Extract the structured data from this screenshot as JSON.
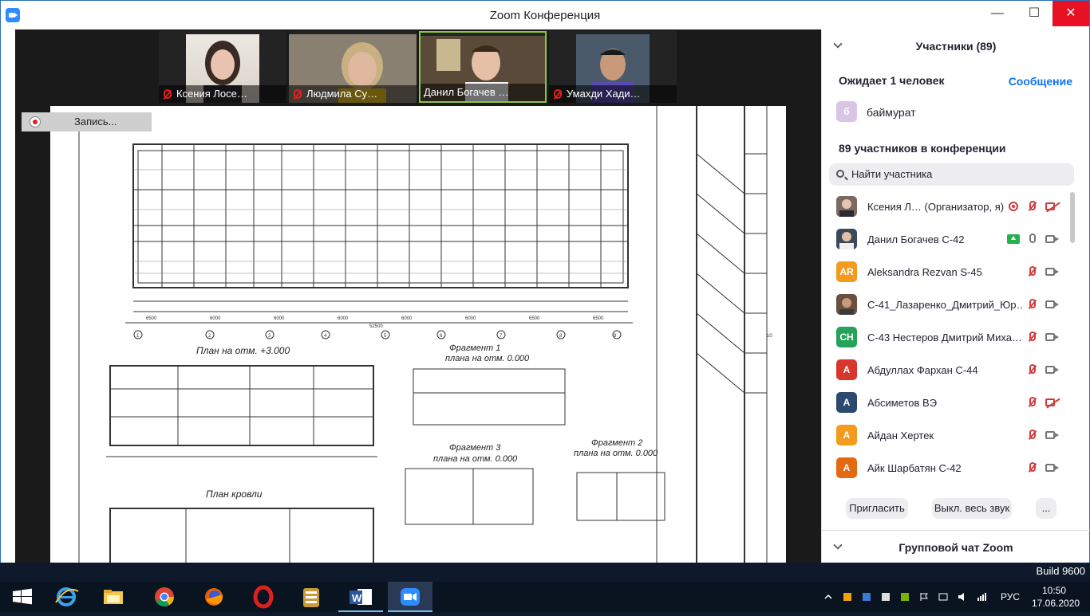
{
  "window": {
    "title": "Zoom Конференция",
    "minimize": "—",
    "maximize": "☐",
    "close": "✕"
  },
  "video": {
    "thumbnails": [
      {
        "name": "Ксения Лосе…",
        "active": false
      },
      {
        "name": "Людмила Су…",
        "active": false
      },
      {
        "name": "Данил Богачев …",
        "active": true
      },
      {
        "name": "Умахди Хади…",
        "active": false
      }
    ],
    "next_icon": "chevron-right-icon",
    "next_glyph": "›",
    "recording_label": "Запись...",
    "drawing": {
      "plan1": "План на отм. +3.000",
      "frag1": "Фрагмент 1",
      "frag1sub": "плана на отм. 0.000",
      "frag2": "Фрагмент 2",
      "frag2sub": "плана на отм. 0.000",
      "frag3": "Фрагмент 3",
      "frag3sub": "плана на отм. 0.000",
      "roof": "План кровли",
      "dim_total": "52500",
      "dim_row": [
        "6500",
        "6000",
        "6000",
        "6000",
        "6000",
        "6000",
        "6500",
        "6500"
      ],
      "axes": [
        "1",
        "2",
        "3",
        "4",
        "5",
        "6",
        "7",
        "8",
        "9",
        "10"
      ]
    }
  },
  "panel": {
    "participants_title": "Участники (89)",
    "waiting": "Ожидает 1 человек",
    "message_button": "Сообщение",
    "waiting_person": {
      "initial": "б",
      "name": "баймурат",
      "color": "#d9c6e6"
    },
    "in_conference": "89 участников в конференции",
    "search_placeholder": "Найти участника",
    "participants": [
      {
        "initial": "",
        "name": "Ксения Л…  (Организатор, я)",
        "color": "#7a6a62",
        "photo": true,
        "rec": true,
        "mic": "off",
        "cam": "off"
      },
      {
        "initial": "",
        "name": "Данил Богачев С-42",
        "color": "#3a4a5a",
        "photo": true,
        "share": true,
        "mic": "on",
        "cam": "on"
      },
      {
        "initial": "AR",
        "name": "Aleksandra Rezvan S-45",
        "color": "#f29b1f",
        "mic": "off",
        "cam": "on"
      },
      {
        "initial": "",
        "name": "С-41_Лазаренко_Дмитрий_Юр…",
        "color": "#6a5040",
        "photo": true,
        "mic": "off",
        "cam": "on"
      },
      {
        "initial": "CH",
        "name": "С-43 Нестеров Дмитрий Миха…",
        "color": "#26a35a",
        "mic": "off",
        "cam": "on"
      },
      {
        "initial": "А",
        "name": "Абдуллах Фархан С-44",
        "color": "#d8372e",
        "mic": "off",
        "cam": "on"
      },
      {
        "initial": "А",
        "name": "Абсиметов ВЭ",
        "color": "#2c4a6e",
        "mic": "off",
        "cam": "off"
      },
      {
        "initial": "А",
        "name": "Айдан Хертек",
        "color": "#f29b1f",
        "mic": "off",
        "cam": "on"
      },
      {
        "initial": "А",
        "name": "Айк Шарбатян С-42",
        "color": "#e36a10",
        "mic": "off",
        "cam": "on"
      }
    ],
    "invite_button": "Пригласить",
    "mute_all_button": "Выкл. весь звук",
    "more_button": "...",
    "chat_title": "Групповой чат Zoom"
  },
  "desktop": {
    "build": "Build 9600"
  },
  "taskbar": {
    "apps": [
      "start",
      "internet-explorer",
      "file-explorer",
      "chrome",
      "firefox",
      "opera",
      "archive",
      "word",
      "zoom"
    ],
    "language": "РУС",
    "time": "10:50",
    "date": "17.06.2020"
  }
}
